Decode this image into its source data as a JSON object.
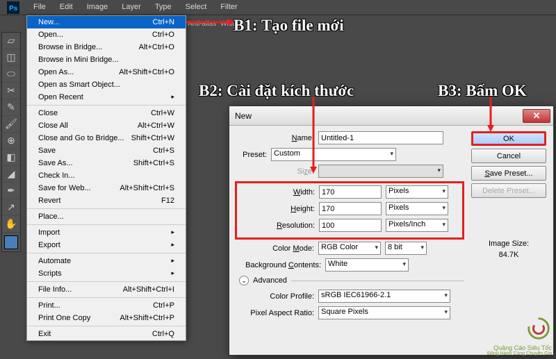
{
  "app": {
    "ps_label": "Ps"
  },
  "menubar": [
    "File",
    "Edit",
    "Image",
    "Layer",
    "Type",
    "Select",
    "Filter"
  ],
  "toolbar_opts": {
    "anti_alias": "Anti-alias",
    "width_label": "Width:"
  },
  "file_menu": {
    "groups": [
      [
        {
          "label": "New...",
          "shortcut": "Ctrl+N",
          "highlighted": true
        },
        {
          "label": "Open...",
          "shortcut": "Ctrl+O"
        },
        {
          "label": "Browse in Bridge...",
          "shortcut": "Alt+Ctrl+O"
        },
        {
          "label": "Browse in Mini Bridge..."
        },
        {
          "label": "Open As...",
          "shortcut": "Alt+Shift+Ctrl+O"
        },
        {
          "label": "Open as Smart Object..."
        },
        {
          "label": "Open Recent",
          "submenu": true
        }
      ],
      [
        {
          "label": "Close",
          "shortcut": "Ctrl+W"
        },
        {
          "label": "Close All",
          "shortcut": "Alt+Ctrl+W"
        },
        {
          "label": "Close and Go to Bridge...",
          "shortcut": "Shift+Ctrl+W"
        },
        {
          "label": "Save",
          "shortcut": "Ctrl+S"
        },
        {
          "label": "Save As...",
          "shortcut": "Shift+Ctrl+S"
        },
        {
          "label": "Check In..."
        },
        {
          "label": "Save for Web...",
          "shortcut": "Alt+Shift+Ctrl+S"
        },
        {
          "label": "Revert",
          "shortcut": "F12"
        }
      ],
      [
        {
          "label": "Place..."
        }
      ],
      [
        {
          "label": "Import",
          "submenu": true
        },
        {
          "label": "Export",
          "submenu": true
        }
      ],
      [
        {
          "label": "Automate",
          "submenu": true
        },
        {
          "label": "Scripts",
          "submenu": true
        }
      ],
      [
        {
          "label": "File Info...",
          "shortcut": "Alt+Shift+Ctrl+I"
        }
      ],
      [
        {
          "label": "Print...",
          "shortcut": "Ctrl+P"
        },
        {
          "label": "Print One Copy",
          "shortcut": "Alt+Shift+Ctrl+P"
        }
      ],
      [
        {
          "label": "Exit",
          "shortcut": "Ctrl+Q"
        }
      ]
    ]
  },
  "dialog": {
    "title": "New",
    "labels": {
      "name": "Name:",
      "preset": "Preset:",
      "size": "Size:",
      "width": "Width:",
      "height": "Height:",
      "resolution": "Resolution:",
      "color_mode": "Color Mode:",
      "bg": "Background Contents:",
      "advanced": "Advanced",
      "color_profile": "Color Profile:",
      "par": "Pixel Aspect Ratio:",
      "image_size": "Image Size:"
    },
    "values": {
      "name": "Untitled-1",
      "preset": "Custom",
      "size": "",
      "width": "170",
      "width_unit": "Pixels",
      "height": "170",
      "height_unit": "Pixels",
      "resolution": "100",
      "resolution_unit": "Pixels/Inch",
      "color_mode": "RGB Color",
      "color_depth": "8 bit",
      "bg": "White",
      "color_profile": "sRGB IEC61966-2.1",
      "par": "Square Pixels",
      "image_size": "84.7K"
    },
    "buttons": {
      "ok": "OK",
      "cancel": "Cancel",
      "save_preset": "Save Preset...",
      "delete_preset": "Delete Preset..."
    }
  },
  "annotations": {
    "b1": "B1: Tạo file mới",
    "b2": "B2: Cài đặt kích thước",
    "b3": "B3: Bấm OK"
  },
  "watermark": {
    "line1": "Quảng Cáo Siêu Tốc",
    "line2": "Đồng Hành Cùng Chuyên Gia"
  },
  "colors": {
    "highlight": "#0a64c8",
    "annotation_red": "#e61e1e"
  }
}
